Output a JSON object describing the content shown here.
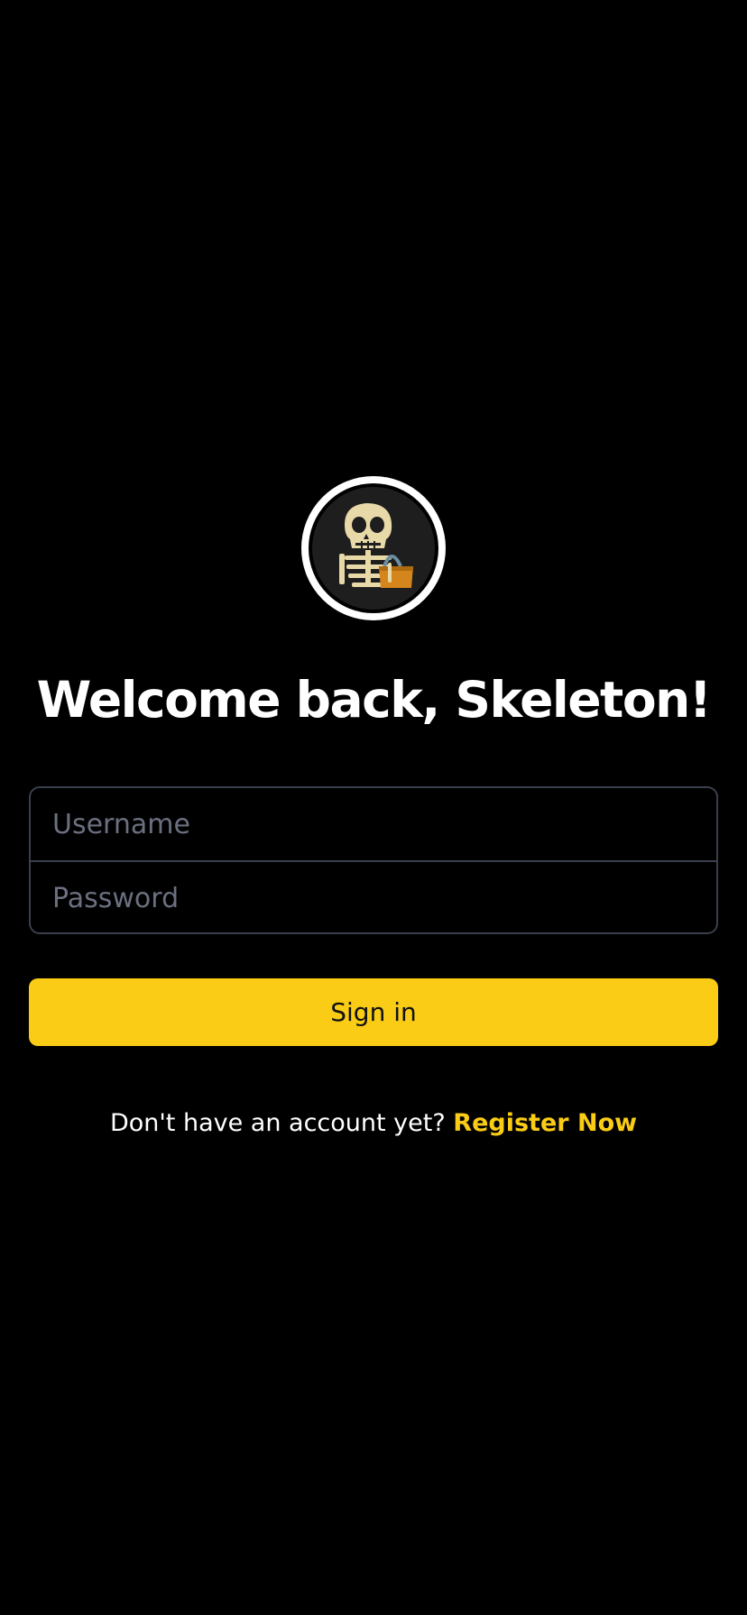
{
  "avatar": {
    "icon": "skeleton-with-basket-icon",
    "alt": "Skeleton avatar"
  },
  "title": "Welcome back, Skeleton!",
  "form": {
    "username_placeholder": "Username",
    "username_value": "",
    "password_placeholder": "Password",
    "password_value": "",
    "signin_label": "Sign in"
  },
  "register": {
    "prompt": "Don't have an account yet?",
    "link_label": "Register Now"
  },
  "colors": {
    "background": "#000000",
    "accent": "#facc15",
    "field_border": "#3a3f4c",
    "placeholder": "#6b7080"
  }
}
